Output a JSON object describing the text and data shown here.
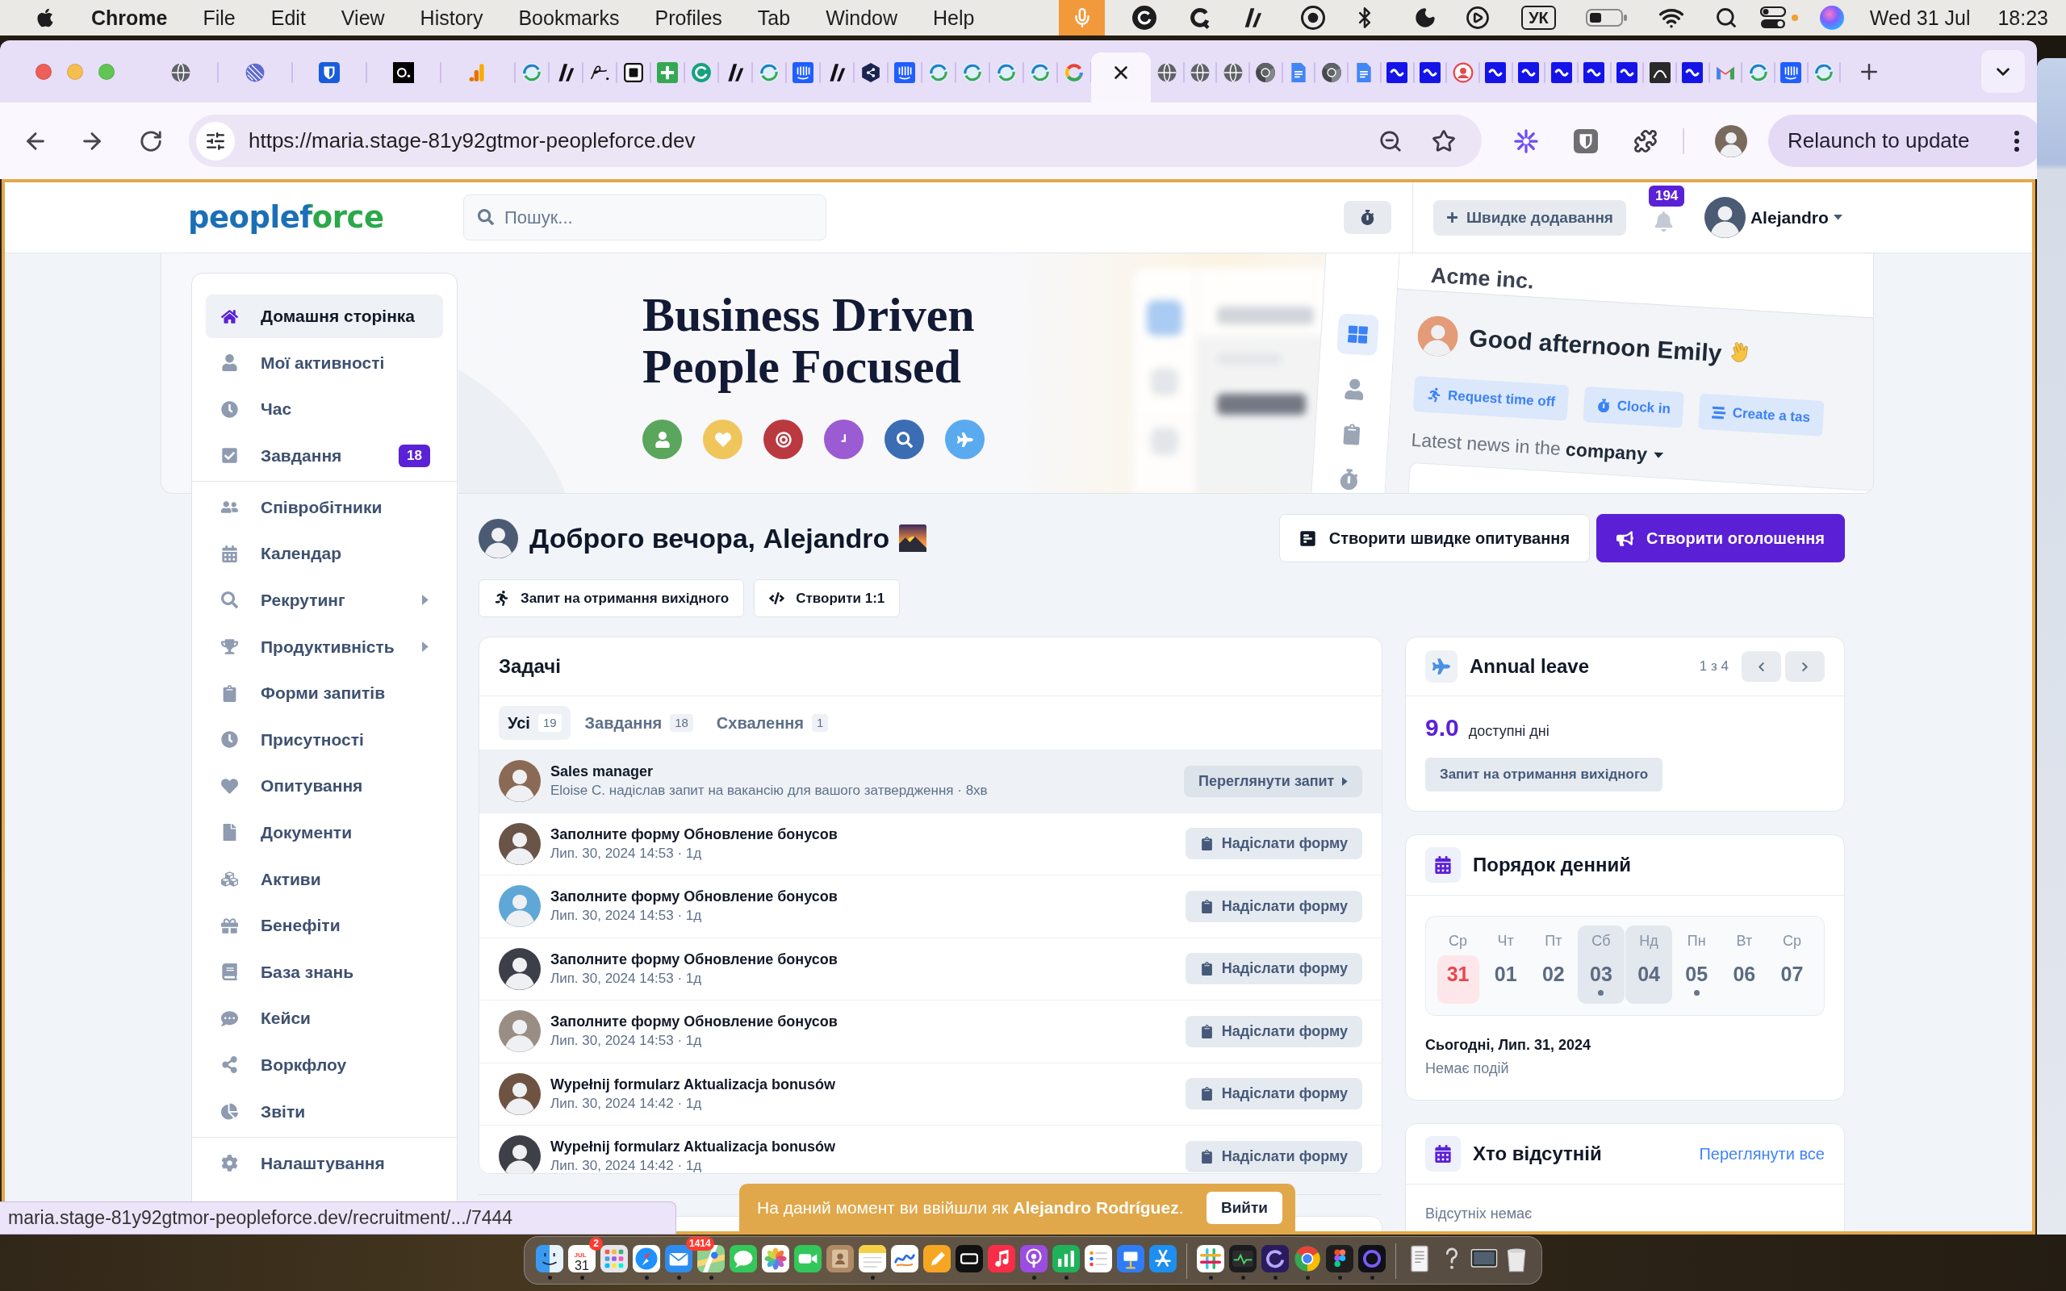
{
  "menu_bar": {
    "app": "Chrome",
    "menus": [
      "File",
      "Edit",
      "View",
      "History",
      "Bookmarks",
      "Profiles",
      "Tab",
      "Window",
      "Help"
    ],
    "input_source": "УК",
    "date": "Wed 31 Jul",
    "time": "18:23"
  },
  "browser": {
    "tabs": [
      {
        "selected": false
      },
      {
        "selected": false
      },
      {
        "selected": false
      },
      {
        "selected": false
      },
      {
        "selected": false
      },
      {
        "selected": false
      },
      {
        "selected": false
      },
      {
        "selected": false
      },
      {
        "selected": false
      },
      {
        "selected": false
      },
      {
        "selected": false
      },
      {
        "selected": false
      },
      {
        "selected": false
      },
      {
        "selected": false
      },
      {
        "selected": false
      },
      {
        "selected": false
      },
      {
        "selected": false
      },
      {
        "selected": false
      },
      {
        "selected": false
      },
      {
        "selected": false
      },
      {
        "selected": false
      },
      {
        "selected": false
      },
      {
        "selected": true
      },
      {
        "selected": false
      },
      {
        "selected": false
      },
      {
        "selected": false
      },
      {
        "selected": false
      },
      {
        "selected": false
      },
      {
        "selected": false
      },
      {
        "selected": false
      },
      {
        "selected": false
      },
      {
        "selected": false
      },
      {
        "selected": false
      },
      {
        "selected": false
      },
      {
        "selected": false
      },
      {
        "selected": false
      },
      {
        "selected": false
      },
      {
        "selected": false
      },
      {
        "selected": false
      },
      {
        "selected": false
      },
      {
        "selected": false
      },
      {
        "selected": false
      },
      {
        "selected": false
      },
      {
        "selected": false
      }
    ],
    "url": "https://maria.stage-81y92gtmor-peopleforce.dev",
    "relaunch": "Relaunch to update",
    "link_preview": "maria.stage-81y92gtmor-peopleforce.dev/recruitment/.../7444"
  },
  "header": {
    "logo": "peopleforce",
    "search": {
      "placeholder": "Пошук..."
    },
    "quick_add": "Швидке додавання",
    "notifications": "194",
    "user": "Alejandro"
  },
  "hero": {
    "headline": [
      "Business Driven",
      "People Focused"
    ],
    "mockup": {
      "company": "Acme inc.",
      "greeting": "Good afternoon Emily",
      "actions": [
        "Request time off",
        "Clock in",
        "Create a tas"
      ],
      "news": "Latest news in the **company**"
    }
  },
  "sidebar": {
    "sections": [
      {
        "items": [
          {
            "label": "Домашня сторінка",
            "selected": true,
            "submenu": false
          },
          {
            "label": "Мої активності",
            "selected": false,
            "submenu": false
          },
          {
            "label": "Час",
            "selected": false,
            "submenu": false
          },
          {
            "label": "Завдання",
            "selected": false,
            "submenu": false,
            "badge": "18"
          }
        ]
      },
      {
        "items": [
          {
            "label": "Співробітники",
            "selected": false,
            "submenu": false
          },
          {
            "label": "Календар",
            "selected": false,
            "submenu": false
          },
          {
            "label": "Рекрутинг",
            "selected": false,
            "submenu": true
          },
          {
            "label": "Продуктивність",
            "selected": false,
            "submenu": true
          },
          {
            "label": "Форми запитів",
            "selected": false,
            "submenu": false
          },
          {
            "label": "Присутності",
            "selected": false,
            "submenu": false
          },
          {
            "label": "Опитування",
            "selected": false,
            "submenu": false
          },
          {
            "label": "Документи",
            "selected": false,
            "submenu": false
          },
          {
            "label": "Активи",
            "selected": false,
            "submenu": false
          },
          {
            "label": "Бенефіти",
            "selected": false,
            "submenu": false
          },
          {
            "label": "База знань",
            "selected": false,
            "submenu": false
          },
          {
            "label": "Кейси",
            "selected": false,
            "submenu": false
          },
          {
            "label": "Воркфлоу",
            "selected": false,
            "submenu": false
          },
          {
            "label": "Звіти",
            "selected": false,
            "submenu": false
          }
        ]
      },
      {
        "items": [
          {
            "label": "Налаштування",
            "selected": false,
            "submenu": false
          }
        ]
      }
    ]
  },
  "greeting": "Доброго вечора, Alejandro",
  "page_actions": [
    {
      "label": "Створити швидке опитування",
      "kind": "secondary"
    },
    {
      "label": "Створити оголошення",
      "kind": "primary"
    }
  ],
  "quick_actions": [
    "Запит на отримання вихідного",
    "Створити 1:1"
  ],
  "tasks": {
    "title": "Задачі",
    "tabs": [
      {
        "label": "Усі",
        "count": "19",
        "selected": true
      },
      {
        "label": "Завдання",
        "count": "18",
        "selected": false
      },
      {
        "label": "Схвалення",
        "count": "1",
        "selected": false
      }
    ],
    "rows": [
      {
        "kind": "approval",
        "title": "Sales manager",
        "meta": "Eloise C. надіслав запит на вакансію для вашого затвердження · 8хв",
        "action": "Переглянути запит",
        "highlighted": true
      },
      {
        "kind": "form",
        "title": "Заполните форму Обновление бонусов",
        "meta": "Лип. 30, 2024 14:53 · 1д",
        "action": "Надіслати форму",
        "highlighted": false
      },
      {
        "kind": "form",
        "title": "Заполните форму Обновление бонусов",
        "meta": "Лип. 30, 2024 14:53 · 1д",
        "action": "Надіслати форму",
        "highlighted": false
      },
      {
        "kind": "form",
        "title": "Заполните форму Обновление бонусов",
        "meta": "Лип. 30, 2024 14:53 · 1д",
        "action": "Надіслати форму",
        "highlighted": false
      },
      {
        "kind": "form",
        "title": "Заполните форму Обновление бонусов",
        "meta": "Лип. 30, 2024 14:53 · 1д",
        "action": "Надіслати форму",
        "highlighted": false
      },
      {
        "kind": "form",
        "title": "Wypełnij formularz Aktualizacja bonusów",
        "meta": "Лип. 30, 2024 14:42 · 1д",
        "action": "Надіслати форму",
        "highlighted": false
      },
      {
        "kind": "form",
        "title": "Wypełnij formularz Aktualizacja bonusów",
        "meta": "Лип. 30, 2024 14:42 · 1д",
        "action": "Надіслати форму",
        "highlighted": false
      }
    ]
  },
  "annual_leave": {
    "title": "Annual leave",
    "pager": "1 з 4",
    "balance": "9.0",
    "balance_label": "доступні дні",
    "action": "Запит на отримання вихідного"
  },
  "agenda": {
    "title": "Порядок денний",
    "days": [
      {
        "weekday": "Ср",
        "date": "31",
        "today": true,
        "weekend": false,
        "events": false
      },
      {
        "weekday": "Чт",
        "date": "01",
        "today": false,
        "weekend": false,
        "events": false
      },
      {
        "weekday": "Пт",
        "date": "02",
        "today": false,
        "weekend": false,
        "events": false
      },
      {
        "weekday": "Сб",
        "date": "03",
        "today": false,
        "weekend": true,
        "events": true
      },
      {
        "weekday": "Нд",
        "date": "04",
        "today": false,
        "weekend": true,
        "events": false
      },
      {
        "weekday": "Пн",
        "date": "05",
        "today": false,
        "weekend": false,
        "events": true
      },
      {
        "weekday": "Вт",
        "date": "06",
        "today": false,
        "weekend": false,
        "events": false
      },
      {
        "weekday": "Ср",
        "date": "07",
        "today": false,
        "weekend": false,
        "events": false
      }
    ],
    "date_label": "Сьогодні, Лип. 31, 2024",
    "empty": "Немає подій"
  },
  "absent": {
    "title": "Хто відсутній",
    "link": "Переглянути все",
    "empty": "Відсутніх немає"
  },
  "banner": {
    "text": "На даний момент ви ввійшли як **Alejandro Rodríguez**.",
    "action": "Вийти"
  },
  "dock": {
    "items": [
      {
        "kind": "app",
        "running": true
      },
      {
        "kind": "calendar",
        "running": true,
        "month": "JUL",
        "day": "31",
        "badge": "2"
      },
      {
        "kind": "app",
        "running": false
      },
      {
        "kind": "app",
        "running": true
      },
      {
        "kind": "app",
        "running": true,
        "badge": "1414"
      },
      {
        "kind": "app",
        "running": true
      },
      {
        "kind": "app",
        "running": false
      },
      {
        "kind": "app",
        "running": false
      },
      {
        "kind": "app",
        "running": false
      },
      {
        "kind": "app",
        "running": false
      },
      {
        "kind": "app",
        "running": true
      },
      {
        "kind": "app",
        "running": false
      },
      {
        "kind": "app",
        "running": false
      },
      {
        "kind": "app",
        "running": false
      },
      {
        "kind": "app",
        "running": false
      },
      {
        "kind": "app",
        "running": true
      },
      {
        "kind": "app",
        "running": true
      },
      {
        "kind": "app",
        "running": false
      },
      {
        "kind": "app",
        "running": false
      },
      {
        "kind": "app",
        "running": false
      },
      {
        "kind": "separator"
      },
      {
        "kind": "app",
        "running": true
      },
      {
        "kind": "app",
        "running": true
      },
      {
        "kind": "app",
        "running": true
      },
      {
        "kind": "app",
        "running": true
      },
      {
        "kind": "app",
        "running": true
      },
      {
        "kind": "app",
        "running": true
      },
      {
        "kind": "separator"
      },
      {
        "kind": "app",
        "running": false
      },
      {
        "kind": "app",
        "running": false
      },
      {
        "kind": "app",
        "running": false
      },
      {
        "kind": "app",
        "running": false
      }
    ]
  }
}
